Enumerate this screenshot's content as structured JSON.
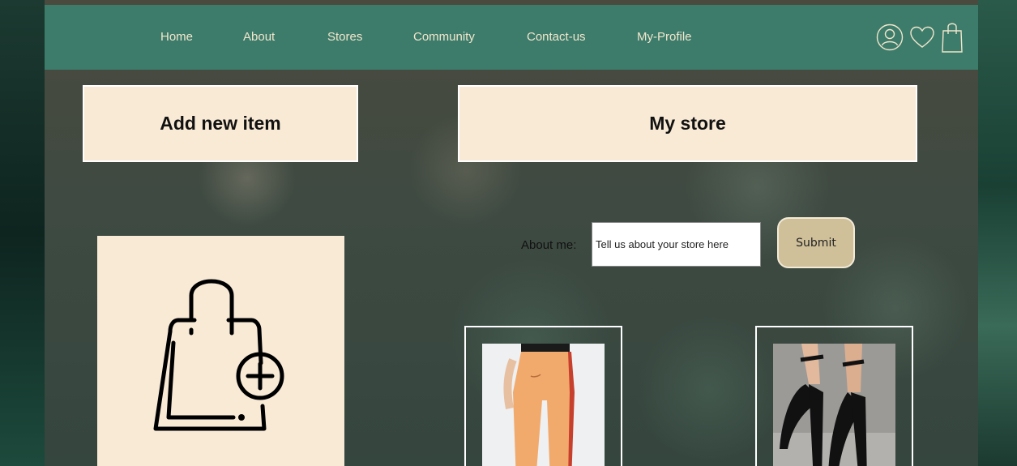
{
  "nav": {
    "links": [
      {
        "label": "Home"
      },
      {
        "label": "About"
      },
      {
        "label": "Stores"
      },
      {
        "label": "Community"
      },
      {
        "label": "Contact-us"
      },
      {
        "label": "My-Profile"
      }
    ],
    "icons": [
      "user-icon",
      "heart-icon",
      "shopping-bag-icon"
    ]
  },
  "panels": {
    "add_item_title": "Add new item",
    "my_store_title": "My store"
  },
  "about": {
    "label": "About me:",
    "placeholder": "Tell us about your store here",
    "submit_label": "Submit"
  },
  "add_card": {
    "icon": "shopping-bag-plus-icon"
  },
  "products": [
    {
      "image": "orange-track-pants"
    },
    {
      "image": "black-strappy-heels"
    }
  ],
  "colors": {
    "nav_bg": "#3d7c6b",
    "nav_text": "#f1e6cd",
    "panel_bg": "#f9ead6",
    "submit_bg": "#cfc09a"
  }
}
